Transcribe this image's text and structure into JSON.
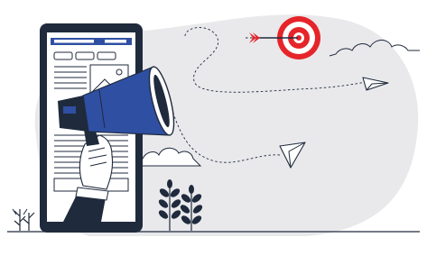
{
  "illustration": {
    "kind": "marketing-megaphone-illustration",
    "colors": {
      "background": "#ffffff",
      "blob": "#e9e9ec",
      "outline": "#1f2a3c",
      "accent_blue": "#2f4fa3",
      "target_red": "#e5252a",
      "phone_screen": "#ffffff",
      "sleeve": "#1f2a3c"
    },
    "elements": [
      "smartphone",
      "megaphone",
      "hand",
      "target-with-arrow",
      "paper-plane",
      "clouds",
      "plants",
      "dashed-flight-paths",
      "ground-line"
    ]
  }
}
